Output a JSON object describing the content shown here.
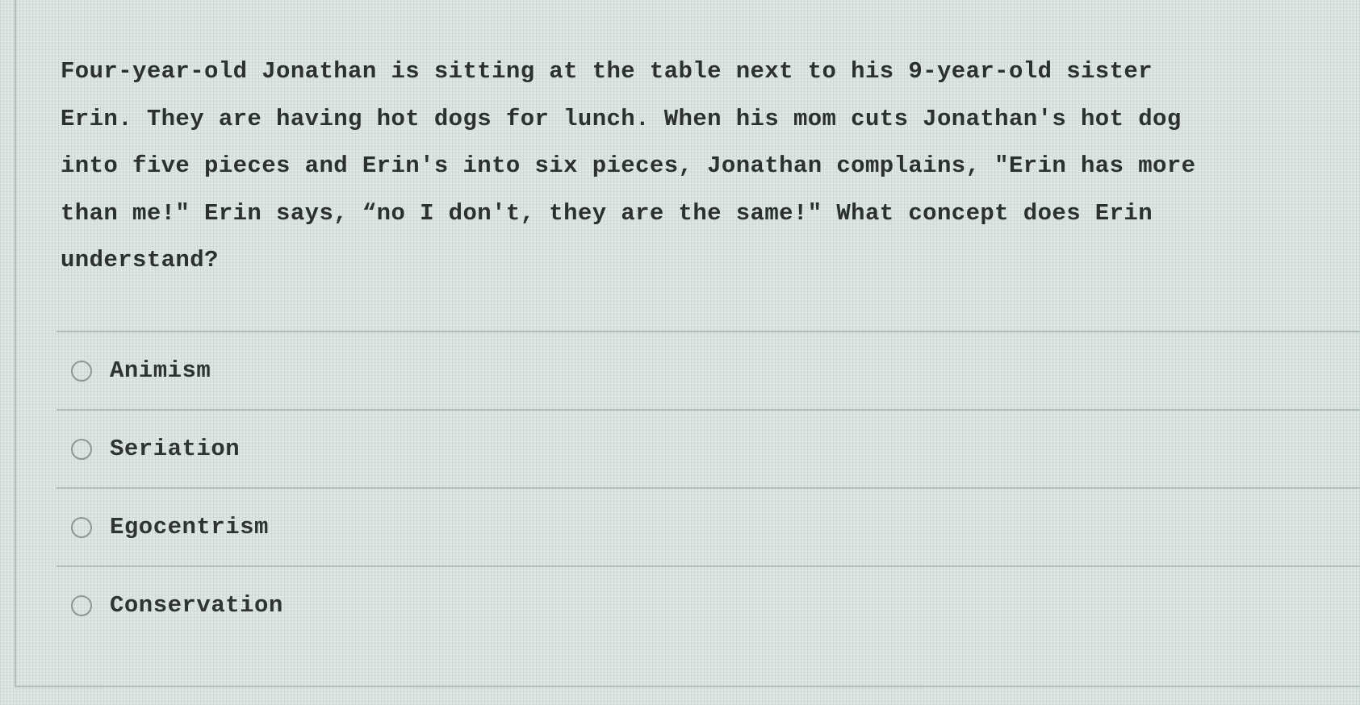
{
  "question": {
    "text": "Four-year-old Jonathan is sitting at the table next to his 9-year-old sister\nErin. They are having hot dogs for lunch. When his mom cuts Jonathan's hot dog\ninto five pieces and Erin's into six pieces, Jonathan complains, \"Erin has more\nthan me!\" Erin says, “no I don't, they are the same!\" What concept does Erin\nunderstand?"
  },
  "options": [
    {
      "label": "Animism",
      "selected": false,
      "icon": "radio-unchecked-icon"
    },
    {
      "label": "Seriation",
      "selected": false,
      "icon": "radio-unchecked-icon"
    },
    {
      "label": "Egocentrism",
      "selected": false,
      "icon": "radio-unchecked-icon"
    },
    {
      "label": "Conservation",
      "selected": false,
      "icon": "radio-unchecked-icon"
    }
  ]
}
